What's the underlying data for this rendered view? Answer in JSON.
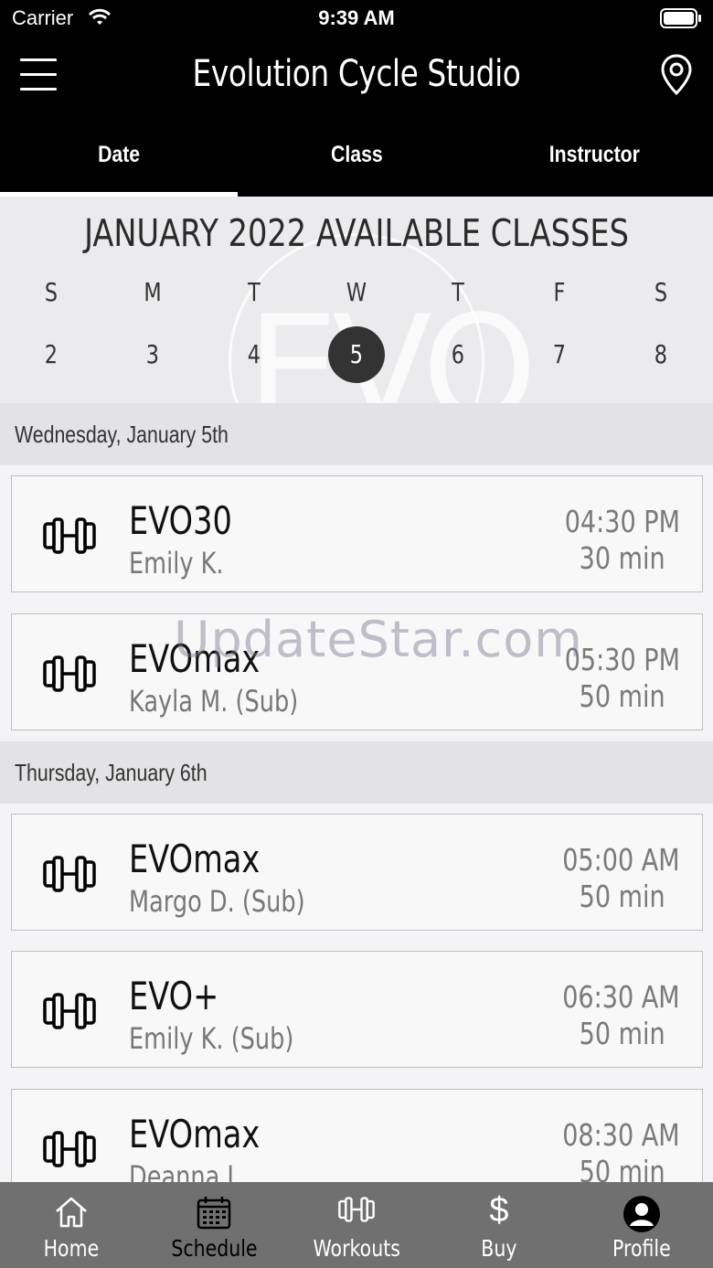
{
  "status_bar": {
    "carrier": "Carrier",
    "time": "9:39 AM"
  },
  "header": {
    "title": "Evolution Cycle Studio"
  },
  "tabs": [
    {
      "label": "Date",
      "active": true
    },
    {
      "label": "Class",
      "active": false
    },
    {
      "label": "Instructor",
      "active": false
    }
  ],
  "calendar": {
    "title": "JANUARY 2022 AVAILABLE CLASSES",
    "watermark": "EVO",
    "weekdays": [
      "S",
      "M",
      "T",
      "W",
      "T",
      "F",
      "S"
    ],
    "dates": [
      "2",
      "3",
      "4",
      "5",
      "6",
      "7",
      "8"
    ],
    "selected_date": "5"
  },
  "schedule": {
    "days": [
      {
        "label": "Wednesday, January 5th",
        "classes": [
          {
            "name": "EVO30",
            "instructor": "Emily K.",
            "time": "04:30 PM",
            "duration": "30 min"
          },
          {
            "name": "EVOmax",
            "instructor": "Kayla M. (Sub)",
            "time": "05:30 PM",
            "duration": "50 min"
          }
        ]
      },
      {
        "label": "Thursday, January 6th",
        "classes": [
          {
            "name": "EVOmax",
            "instructor": "Margo D. (Sub)",
            "time": "05:00 AM",
            "duration": "50 min"
          },
          {
            "name": "EVO+",
            "instructor": "Emily K. (Sub)",
            "time": "06:30 AM",
            "duration": "50 min"
          },
          {
            "name": "EVOmax",
            "instructor": "Deanna L.",
            "time": "08:30 AM",
            "duration": "50 min"
          }
        ]
      }
    ]
  },
  "watermark_overlay": "UpdateStar.com",
  "bottom_nav": [
    {
      "label": "Home",
      "icon": "home-icon"
    },
    {
      "label": "Schedule",
      "icon": "calendar-icon",
      "active": true
    },
    {
      "label": "Workouts",
      "icon": "dumbbell-icon"
    },
    {
      "label": "Buy",
      "icon": "dollar-icon"
    },
    {
      "label": "Profile",
      "icon": "profile-icon"
    }
  ]
}
